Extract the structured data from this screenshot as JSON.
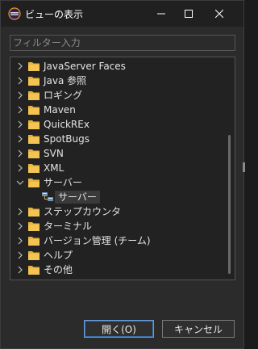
{
  "window": {
    "title": "ビューの表示"
  },
  "filter": {
    "placeholder": "フィルター入力"
  },
  "tree": {
    "items": [
      {
        "label": "JavaServer Faces",
        "expanded": false
      },
      {
        "label": "Java 参照",
        "expanded": false
      },
      {
        "label": "ロギング",
        "expanded": false
      },
      {
        "label": "Maven",
        "expanded": false
      },
      {
        "label": "QuickREx",
        "expanded": false
      },
      {
        "label": "SpotBugs",
        "expanded": false
      },
      {
        "label": "SVN",
        "expanded": false
      },
      {
        "label": "XML",
        "expanded": false
      },
      {
        "label": "サーバー",
        "expanded": true
      },
      {
        "label": "ステップカウンタ",
        "expanded": false
      },
      {
        "label": "ターミナル",
        "expanded": false
      },
      {
        "label": "バージョン管理 (チーム)",
        "expanded": false
      },
      {
        "label": "ヘルプ",
        "expanded": false
      },
      {
        "label": "その他",
        "expanded": false
      }
    ],
    "selected_child": "サーバー"
  },
  "buttons": {
    "open": "開く(O)",
    "cancel": "キャンセル"
  },
  "colors": {
    "folder": "#e8b23d",
    "accent": "#6d9bd8"
  }
}
